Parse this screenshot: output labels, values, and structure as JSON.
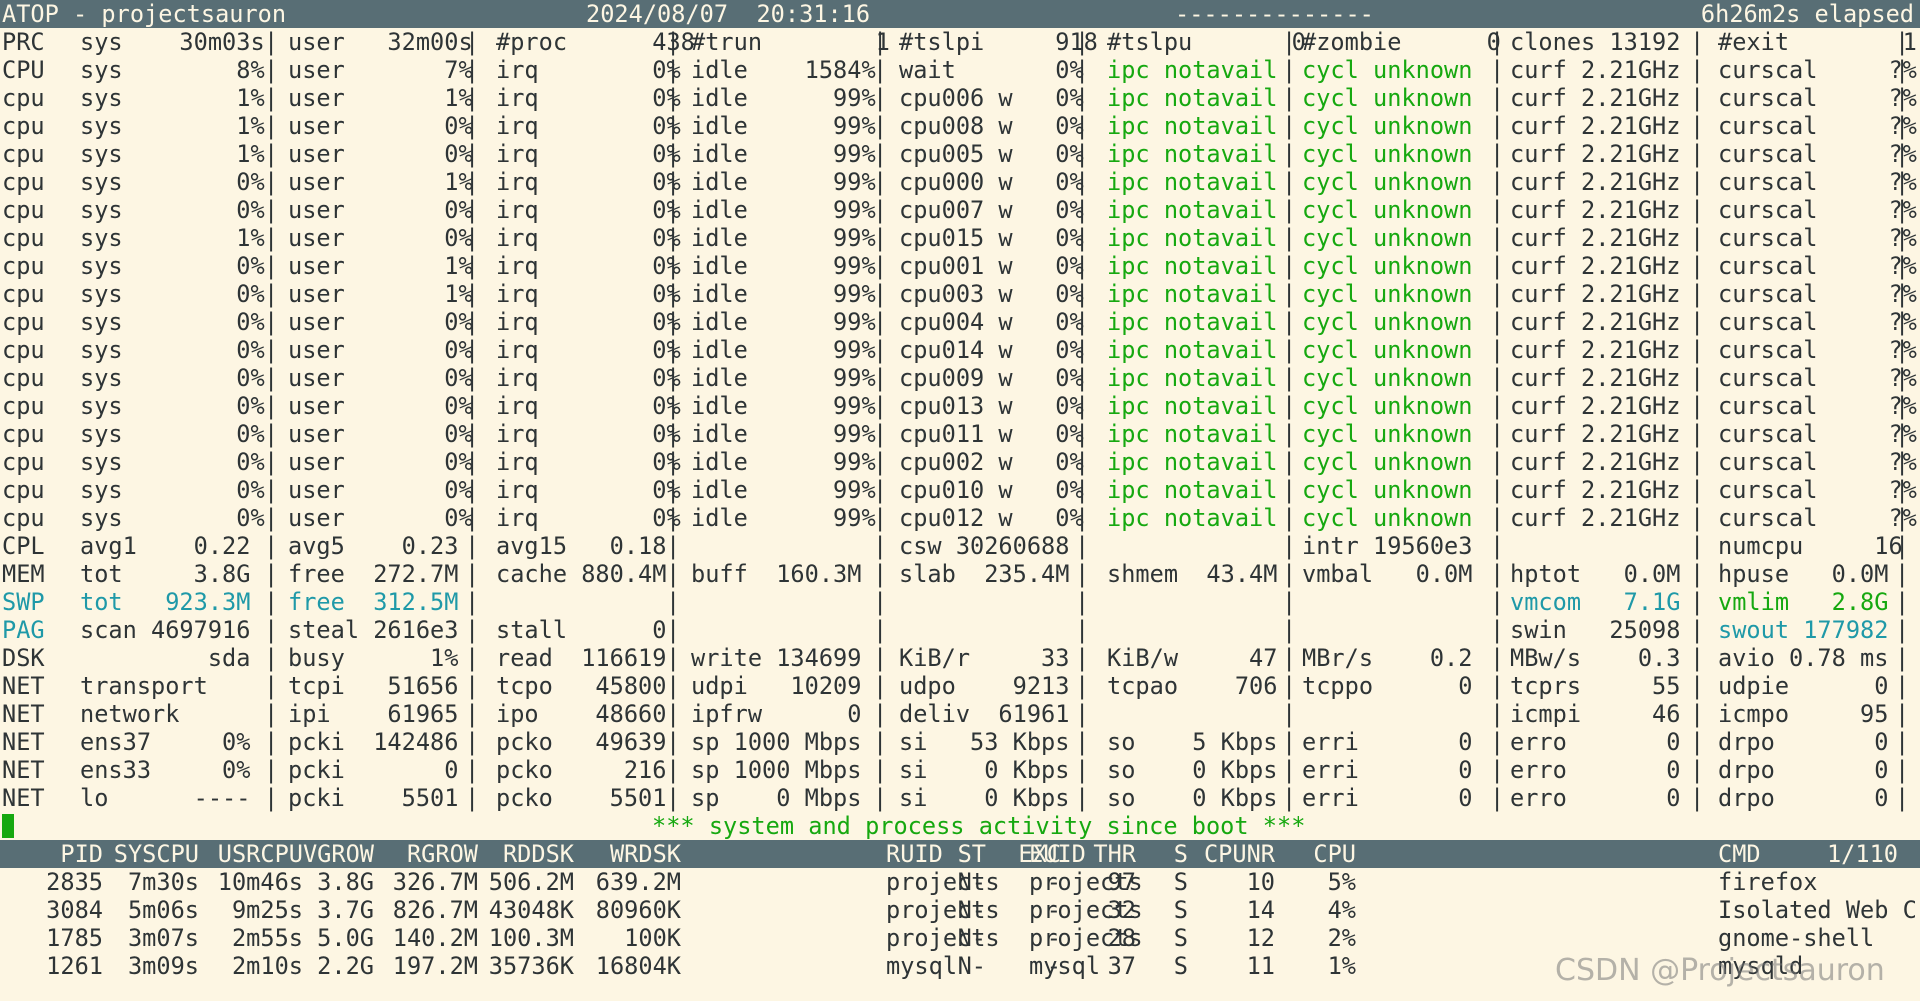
{
  "titlebar": {
    "title": "ATOP - projectsauron",
    "datetime": "2024/08/07  20:31:16",
    "dashes": "--------------",
    "elapsed": "6h26m2s elapsed"
  },
  "system_rows": [
    {
      "label": "PRC",
      "cells": [
        "sys    30m03s",
        "user   32m00s",
        "#proc      438",
        "#trun        1",
        "#tslpi     918",
        "#tslpu       0",
        "#zombie      0",
        "clones 13192",
        "#exit        1"
      ]
    },
    {
      "label": "CPU",
      "cells": [
        "sys        8%",
        "user       7%",
        "irq        0%",
        "idle    1584%",
        "wait       0%",
        "ipc notavail",
        "cycl unknown",
        "curf 2.21GHz",
        "curscal     ?%"
      ]
    },
    {
      "label": "cpu",
      "cells": [
        "sys        1%",
        "user       1%",
        "irq        0%",
        "idle      99%",
        "cpu006 w   0%",
        "ipc notavail",
        "cycl unknown",
        "curf 2.21GHz",
        "curscal     ?%"
      ]
    },
    {
      "label": "cpu",
      "cells": [
        "sys        1%",
        "user       0%",
        "irq        0%",
        "idle      99%",
        "cpu008 w   0%",
        "ipc notavail",
        "cycl unknown",
        "curf 2.21GHz",
        "curscal     ?%"
      ]
    },
    {
      "label": "cpu",
      "cells": [
        "sys        1%",
        "user       0%",
        "irq        0%",
        "idle      99%",
        "cpu005 w   0%",
        "ipc notavail",
        "cycl unknown",
        "curf 2.21GHz",
        "curscal     ?%"
      ]
    },
    {
      "label": "cpu",
      "cells": [
        "sys        0%",
        "user       1%",
        "irq        0%",
        "idle      99%",
        "cpu000 w   0%",
        "ipc notavail",
        "cycl unknown",
        "curf 2.21GHz",
        "curscal     ?%"
      ]
    },
    {
      "label": "cpu",
      "cells": [
        "sys        0%",
        "user       0%",
        "irq        0%",
        "idle      99%",
        "cpu007 w   0%",
        "ipc notavail",
        "cycl unknown",
        "curf 2.21GHz",
        "curscal     ?%"
      ]
    },
    {
      "label": "cpu",
      "cells": [
        "sys        1%",
        "user       0%",
        "irq        0%",
        "idle      99%",
        "cpu015 w   0%",
        "ipc notavail",
        "cycl unknown",
        "curf 2.21GHz",
        "curscal     ?%"
      ]
    },
    {
      "label": "cpu",
      "cells": [
        "sys        0%",
        "user       1%",
        "irq        0%",
        "idle      99%",
        "cpu001 w   0%",
        "ipc notavail",
        "cycl unknown",
        "curf 2.21GHz",
        "curscal     ?%"
      ]
    },
    {
      "label": "cpu",
      "cells": [
        "sys        0%",
        "user       1%",
        "irq        0%",
        "idle      99%",
        "cpu003 w   0%",
        "ipc notavail",
        "cycl unknown",
        "curf 2.21GHz",
        "curscal     ?%"
      ]
    },
    {
      "label": "cpu",
      "cells": [
        "sys        0%",
        "user       0%",
        "irq        0%",
        "idle      99%",
        "cpu004 w   0%",
        "ipc notavail",
        "cycl unknown",
        "curf 2.21GHz",
        "curscal     ?%"
      ]
    },
    {
      "label": "cpu",
      "cells": [
        "sys        0%",
        "user       0%",
        "irq        0%",
        "idle      99%",
        "cpu014 w   0%",
        "ipc notavail",
        "cycl unknown",
        "curf 2.21GHz",
        "curscal     ?%"
      ]
    },
    {
      "label": "cpu",
      "cells": [
        "sys        0%",
        "user       0%",
        "irq        0%",
        "idle      99%",
        "cpu009 w   0%",
        "ipc notavail",
        "cycl unknown",
        "curf 2.21GHz",
        "curscal     ?%"
      ]
    },
    {
      "label": "cpu",
      "cells": [
        "sys        0%",
        "user       0%",
        "irq        0%",
        "idle      99%",
        "cpu013 w   0%",
        "ipc notavail",
        "cycl unknown",
        "curf 2.21GHz",
        "curscal     ?%"
      ]
    },
    {
      "label": "cpu",
      "cells": [
        "sys        0%",
        "user       0%",
        "irq        0%",
        "idle      99%",
        "cpu011 w   0%",
        "ipc notavail",
        "cycl unknown",
        "curf 2.21GHz",
        "curscal     ?%"
      ]
    },
    {
      "label": "cpu",
      "cells": [
        "sys        0%",
        "user       0%",
        "irq        0%",
        "idle      99%",
        "cpu002 w   0%",
        "ipc notavail",
        "cycl unknown",
        "curf 2.21GHz",
        "curscal     ?%"
      ]
    },
    {
      "label": "cpu",
      "cells": [
        "sys        0%",
        "user       0%",
        "irq        0%",
        "idle      99%",
        "cpu010 w   0%",
        "ipc notavail",
        "cycl unknown",
        "curf 2.21GHz",
        "curscal     ?%"
      ]
    },
    {
      "label": "cpu",
      "cells": [
        "sys        0%",
        "user       0%",
        "irq        0%",
        "idle      99%",
        "cpu012 w   0%",
        "ipc notavail",
        "cycl unknown",
        "curf 2.21GHz",
        "curscal     ?%"
      ]
    },
    {
      "label": "CPL",
      "cells": [
        "avg1    0.22",
        "avg5    0.23",
        "avg15   0.18",
        "",
        "csw 30260688",
        "",
        "intr 19560e3",
        "",
        "numcpu     16"
      ]
    },
    {
      "label": "MEM",
      "cells": [
        "tot     3.8G",
        "free  272.7M",
        "cache 880.4M",
        "buff  160.3M",
        "slab  235.4M",
        "shmem  43.4M",
        "vmbal   0.0M",
        "hptot   0.0M",
        "hpuse   0.0M"
      ]
    },
    {
      "label": "SWP",
      "cells": [
        "tot   923.3M",
        "free  312.5M",
        "",
        "",
        "",
        "",
        "",
        "vmcom   7.1G",
        "vmlim   2.8G"
      ]
    },
    {
      "label": "PAG",
      "cells": [
        "scan 4697916",
        "steal 2616e3",
        "stall      0",
        "",
        "",
        "",
        "",
        "swin   25098",
        "swout 177982"
      ]
    },
    {
      "label": "DSK",
      "cells": [
        "         sda",
        "busy      1%",
        "read  116619",
        "write 134699",
        "KiB/r     33",
        "KiB/w     47",
        "MBr/s    0.2",
        "MBw/s    0.3",
        "avio 0.78 ms"
      ]
    },
    {
      "label": "NET",
      "cells": [
        "transport   ",
        "tcpi   51656",
        "tcpo   45800",
        "udpi   10209",
        "udpo    9213",
        "tcpao    706",
        "tcppo      0",
        "tcprs     55",
        "udpie      0"
      ]
    },
    {
      "label": "NET",
      "cells": [
        "network     ",
        "ipi    61965",
        "ipo    48660",
        "ipfrw      0",
        "deliv  61961",
        "",
        "",
        "icmpi     46",
        "icmpo     95"
      ]
    },
    {
      "label": "NET",
      "cells": [
        "ens37     0%",
        "pcki  142486",
        "pcko   49639",
        "sp 1000 Mbps",
        "si   53 Kbps",
        "so    5 Kbps",
        "erri       0",
        "erro       0",
        "drpo       0"
      ]
    },
    {
      "label": "NET",
      "cells": [
        "ens33     0%",
        "pcki       0",
        "pcko     216",
        "sp 1000 Mbps",
        "si    0 Kbps",
        "so    0 Kbps",
        "erri       0",
        "erro       0",
        "drpo       0"
      ]
    },
    {
      "label": "NET",
      "cells": [
        "lo      ----",
        "pcki    5501",
        "pcko    5501",
        "sp    0 Mbps",
        "si    0 Kbps",
        "so    0 Kbps",
        "erri       0",
        "erro       0",
        "drpo       0"
      ]
    }
  ],
  "colors": {
    "green": "#16a810",
    "cyan": "#1f99a8",
    "header_bg": "#586e75",
    "background": "#fdf6e3"
  },
  "banner": "*** system and process activity since boot ***",
  "process_table": {
    "columns": [
      "PID",
      "SYSCPU",
      "USRCPU",
      "VGROW",
      "RGROW",
      "RDDSK",
      "WRDSK",
      "RUID",
      "EUID",
      "ST",
      "EXC",
      "THR",
      "S",
      "CPUNR",
      "CPU",
      "CMD"
    ],
    "page": "1/110",
    "rows": [
      [
        "2835",
        "7m30s",
        "10m46s",
        "3.8G",
        "326.7M",
        "506.2M",
        "639.2M",
        "projects",
        "projects",
        "N-",
        "-",
        "97",
        "S",
        "10",
        "5%",
        "firefox"
      ],
      [
        "3084",
        "5m06s",
        "9m25s",
        "3.7G",
        "826.7M",
        "43048K",
        "80960K",
        "projects",
        "projects",
        "N-",
        "-",
        "32",
        "S",
        "14",
        "4%",
        "Isolated Web C"
      ],
      [
        "1785",
        "3m07s",
        "2m55s",
        "5.0G",
        "140.2M",
        "100.3M",
        "100K",
        "projects",
        "projects",
        "N-",
        "-",
        "28",
        "S",
        "12",
        "2%",
        "gnome-shell"
      ],
      [
        "1261",
        "3m09s",
        "2m10s",
        "2.2G",
        "197.2M",
        "35736K",
        "16804K",
        "mysql",
        "mysql",
        "N-",
        "-",
        "37",
        "S",
        "11",
        "1%",
        "mysqld"
      ]
    ]
  },
  "watermark": "CSDN @Projectsauron"
}
